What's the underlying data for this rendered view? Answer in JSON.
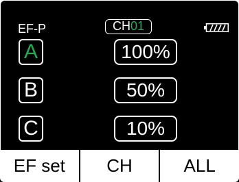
{
  "header": {
    "mode_label": "EF-P",
    "channel_prefix": "CH",
    "channel_number": "01",
    "battery_icon": "battery-full-icon",
    "battery_level": 1.0
  },
  "groups": [
    {
      "letter": "A",
      "value": "100%",
      "active": true
    },
    {
      "letter": "B",
      "value": "50%",
      "active": false
    },
    {
      "letter": "C",
      "value": "10%",
      "active": false
    }
  ],
  "softkeys": [
    {
      "label": "EF set"
    },
    {
      "label": "CH"
    },
    {
      "label": "ALL"
    }
  ],
  "colors": {
    "background": "#000000",
    "foreground": "#ffffff",
    "accent_green": "#22aa55"
  }
}
